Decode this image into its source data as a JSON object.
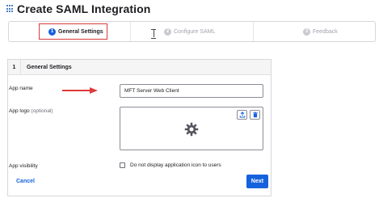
{
  "header": {
    "title": "Create SAML Integration",
    "icon": "app-grid-icon"
  },
  "stepper": {
    "steps": [
      {
        "number": "1",
        "label": "General Settings",
        "state": "active"
      },
      {
        "number": "2",
        "label": "Configure SAML",
        "state": "inactive"
      },
      {
        "number": "3",
        "label": "Feedback",
        "state": "inactive"
      }
    ]
  },
  "card": {
    "step_number": "1",
    "title": "General Settings",
    "app_name": {
      "label": "App name",
      "value": "MFT Server Web Client"
    },
    "app_logo": {
      "label": "App logo",
      "optional": "(optional)",
      "upload_icon": "upload-icon",
      "delete_icon": "trash-icon",
      "placeholder_icon": "gear-icon"
    },
    "app_visibility": {
      "label": "App visibility",
      "checkbox_label": "Do not display application icon to users",
      "checked": false
    }
  },
  "actions": {
    "cancel_label": "Cancel",
    "next_label": "Next"
  },
  "colors": {
    "primary": "#1662dd",
    "highlight": "#d93a3a",
    "arrow": "#e03a3a"
  }
}
